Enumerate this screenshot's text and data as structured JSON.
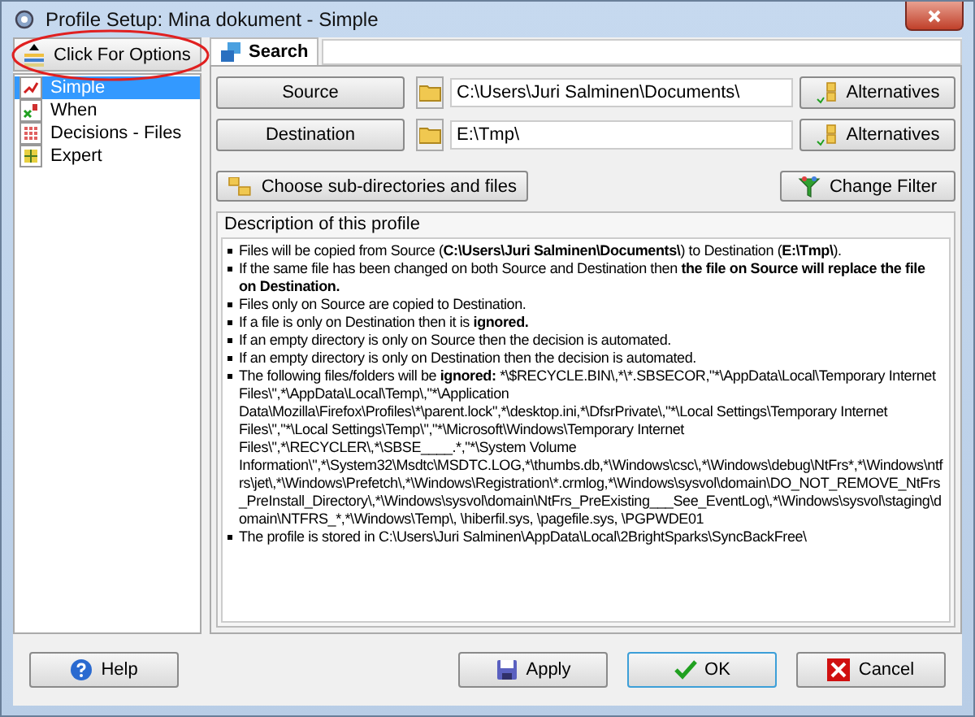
{
  "window": {
    "title": "Profile Setup: Mina dokument - Simple"
  },
  "options_button": {
    "label": "Click For Options",
    "highlighted": true
  },
  "sidebar": {
    "items": [
      {
        "label": "Simple",
        "selected": true,
        "kind": "simple"
      },
      {
        "label": "When",
        "selected": false,
        "kind": "when"
      },
      {
        "label": "Decisions - Files",
        "selected": false,
        "kind": "decisions"
      },
      {
        "label": "Expert",
        "selected": false,
        "kind": "expert"
      }
    ]
  },
  "tabs": [
    {
      "label": "Search",
      "selected": true
    }
  ],
  "source": {
    "button": "Source",
    "value": "C:\\Users\\Juri Salminen\\Documents\\",
    "alternatives": "Alternatives"
  },
  "destination": {
    "button": "Destination",
    "value": "E:\\Tmp\\",
    "alternatives": "Alternatives"
  },
  "choose_button": "Choose sub-directories and files",
  "filter_button": "Change Filter",
  "description": {
    "title": "Description of this profile",
    "items": [
      [
        {
          "text": "Files will be copied from Source (",
          "bold": false
        },
        {
          "text": "C:\\Users\\Juri Salminen\\Documents\\",
          "bold": true
        },
        {
          "text": ") to Destination (",
          "bold": false
        },
        {
          "text": "E:\\Tmp\\",
          "bold": true
        },
        {
          "text": ").",
          "bold": false
        }
      ],
      [
        {
          "text": "If the same file has been changed on both Source and Destination then ",
          "bold": false
        },
        {
          "text": "the file on Source will replace the file on Destination.",
          "bold": true
        }
      ],
      [
        {
          "text": "Files only on Source are copied to Destination.",
          "bold": false
        }
      ],
      [
        {
          "text": "If a file is only on Destination then it is ",
          "bold": false
        },
        {
          "text": "ignored.",
          "bold": true
        }
      ],
      [
        {
          "text": "If an empty directory is only on Source then the decision is automated.",
          "bold": false
        }
      ],
      [
        {
          "text": "If an empty directory is only on Destination then the decision is automated.",
          "bold": false
        }
      ],
      [
        {
          "text": "The following files/folders will be ",
          "bold": false
        },
        {
          "text": "ignored:",
          "bold": true
        },
        {
          "text": " *\\$RECYCLE.BIN\\,*\\*.SBSECOR,\"*\\AppData\\Local\\Temporary Internet Files\\\",*\\AppData\\Local\\Temp\\,\"*\\Application Data\\Mozilla\\Firefox\\Profiles\\*\\parent.lock\",*\\desktop.ini,*\\DfsrPrivate\\,\"*\\Local Settings\\Temporary Internet Files\\\",\"*\\Local Settings\\Temp\\\",\"*\\Microsoft\\Windows\\Temporary Internet Files\\\",*\\RECYCLER\\,*\\SBSE____.*,\"*\\System Volume Information\\\",*\\System32\\Msdtc\\MSDTC.LOG,*\\thumbs.db,*\\Windows\\csc\\,*\\Windows\\debug\\NtFrs*,*\\Windows\\ntfrs\\jet\\,*\\Windows\\Prefetch\\,*\\Windows\\Registration\\*.crmlog,*\\Windows\\sysvol\\domain\\DO_NOT_REMOVE_NtFrs_PreInstall_Directory\\,*\\Windows\\sysvol\\domain\\NtFrs_PreExisting___See_EventLog\\,*\\Windows\\sysvol\\staging\\domain\\NTFRS_*,*\\Windows\\Temp\\, \\hiberfil.sys, \\pagefile.sys, \\PGPWDE01",
          "bold": false
        }
      ],
      [
        {
          "text": "The profile is stored in C:\\Users\\Juri Salminen\\AppData\\Local\\2BrightSparks\\SyncBackFree\\",
          "bold": false
        }
      ]
    ]
  },
  "buttons": [
    {
      "label": "Help",
      "kind": "help"
    },
    {
      "label": "Apply",
      "kind": "apply"
    },
    {
      "label": "OK",
      "kind": "ok"
    },
    {
      "label": "Cancel",
      "kind": "cancel"
    }
  ]
}
